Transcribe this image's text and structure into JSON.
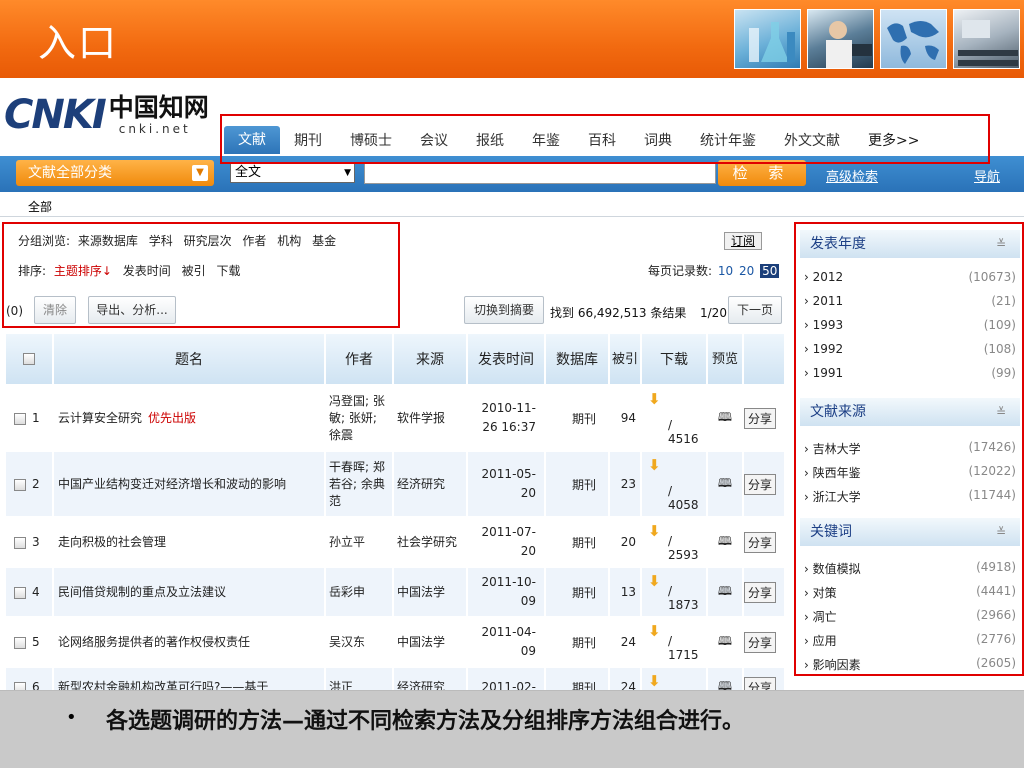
{
  "slide": {
    "title": "入口",
    "caption": "各选题调研的方法—通过不同检索方法及分组排序方法组合进行。"
  },
  "logo": {
    "mark": "CNKI",
    "chinese": "中国知网",
    "english": "cnki.net"
  },
  "db_tabs": [
    "文献",
    "期刊",
    "博硕士",
    "会议",
    "报纸",
    "年鉴",
    "百科",
    "词典",
    "统计年鉴",
    "外文文献",
    "更多>>"
  ],
  "search": {
    "category_button": "文献全部分类",
    "field_select": "全文",
    "input_value": "",
    "search_button": "检 索",
    "advanced_link": "高级检索",
    "nav_link": "导航"
  },
  "crumb": "全部",
  "filters": {
    "group_label": "分组浏览:",
    "group_options": [
      "来源数据库",
      "学科",
      "研究层次",
      "作者",
      "机构",
      "基金"
    ],
    "subscribe": "订阅",
    "sort_label": "排序:",
    "sort_options": [
      "主题排序↓",
      "发表时间",
      "被引",
      "下载"
    ],
    "per_page_label": "每页记录数:",
    "per_page_options": [
      "10",
      "20",
      "50"
    ],
    "per_page_selected": "50",
    "selected_count": "(0)",
    "clear_button": "清除",
    "export_button": "导出、分析...",
    "summary_button": "切换到摘要",
    "found_text": "找到 66,492,513 条结果",
    "page_indicator": "1/20",
    "next_button": "下一页"
  },
  "table": {
    "headers": [
      "题名",
      "作者",
      "来源",
      "发表时间",
      "数据库",
      "被引",
      "下载",
      "预览"
    ],
    "rows": [
      {
        "num": "1",
        "title": "云计算安全研究",
        "badge": "优先出版",
        "author": "冯登国; 张敏; 张妍; 徐震",
        "source": "软件学报",
        "date": "2010-11-26 16:37",
        "db": "期刊",
        "cited": "94",
        "downloads": "/ 4516",
        "share": "分享"
      },
      {
        "num": "2",
        "title": "中国产业结构变迁对经济增长和波动的影响",
        "badge": "",
        "author": "干春晖; 郑若谷; 余典范",
        "source": "经济研究",
        "date": "2011-05-20",
        "db": "期刊",
        "cited": "23",
        "downloads": "/ 4058",
        "share": "分享"
      },
      {
        "num": "3",
        "title": "走向积极的社会管理",
        "badge": "",
        "author": "孙立平",
        "source": "社会学研究",
        "date": "2011-07-20",
        "db": "期刊",
        "cited": "20",
        "downloads": "/ 2593",
        "share": "分享"
      },
      {
        "num": "4",
        "title": "民间借贷规制的重点及立法建议",
        "badge": "",
        "author": "岳彩申",
        "source": "中国法学",
        "date": "2011-10-09",
        "db": "期刊",
        "cited": "13",
        "downloads": "/ 1873",
        "share": "分享"
      },
      {
        "num": "5",
        "title": "论网络服务提供者的著作权侵权责任",
        "badge": "",
        "author": "吴汉东",
        "source": "中国法学",
        "date": "2011-04-09",
        "db": "期刊",
        "cited": "24",
        "downloads": "/ 1715",
        "share": "分享"
      },
      {
        "num": "6",
        "title": "新型农村金融机构改革可行吗?——基于",
        "badge": "",
        "author": "洪正",
        "source": "经济研究",
        "date": "2011-02-",
        "db": "期刊",
        "cited": "24",
        "downloads": "",
        "share": "分享"
      }
    ]
  },
  "sidebar": {
    "groups": [
      {
        "title": "发表年度",
        "items": [
          {
            "label": "2012",
            "count": "(10673)"
          },
          {
            "label": "2011",
            "count": "(21)"
          },
          {
            "label": "1993",
            "count": "(109)"
          },
          {
            "label": "1992",
            "count": "(108)"
          },
          {
            "label": "1991",
            "count": "(99)"
          }
        ]
      },
      {
        "title": "文献来源",
        "items": [
          {
            "label": "吉林大学",
            "count": "(17426)"
          },
          {
            "label": "陕西年鉴",
            "count": "(12022)"
          },
          {
            "label": "浙江大学",
            "count": "(11744)"
          }
        ]
      },
      {
        "title": "关键词",
        "items": [
          {
            "label": "数值模拟",
            "count": "(4918)"
          },
          {
            "label": "对策",
            "count": "(4441)"
          },
          {
            "label": "凋亡",
            "count": "(2966)"
          },
          {
            "label": "应用",
            "count": "(2776)"
          },
          {
            "label": "影响因素",
            "count": "(2605)"
          }
        ]
      }
    ]
  },
  "colors": {
    "header_orange": "#f26a10",
    "search_blue": "#2a72b8",
    "button_orange": "#f08a0c",
    "highlight_red": "#e00000",
    "link_blue": "#1c3f85"
  }
}
